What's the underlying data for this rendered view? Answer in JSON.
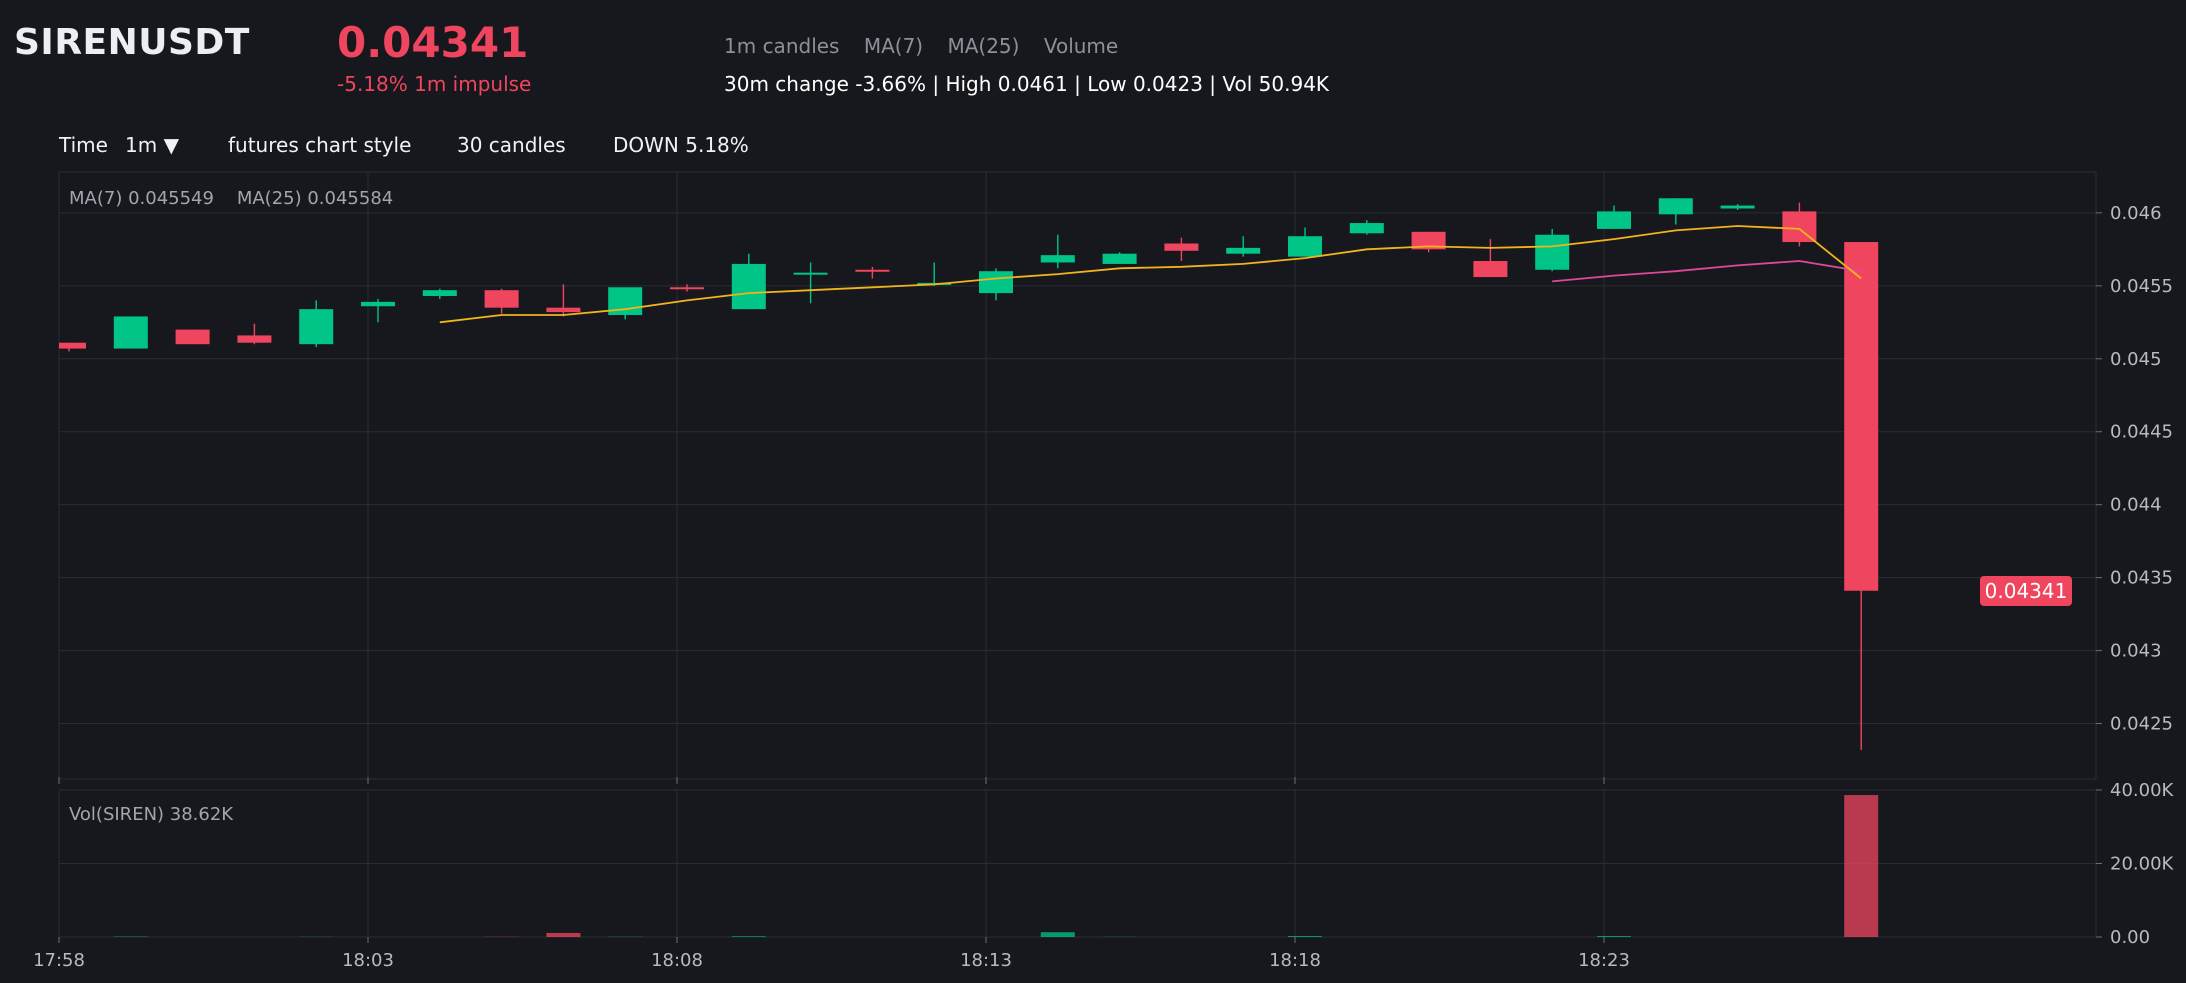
{
  "header": {
    "symbol": "SIRENUSDT",
    "price": "0.04341",
    "impulse": "-5.18% 1m impulse",
    "legend": {
      "candles": "1m candles",
      "ma7": "MA(7)",
      "ma25": "MA(25)",
      "volume": "Volume"
    },
    "stats": "30m change -3.66% | High 0.0461 | Low 0.0423 | Vol 50.94K"
  },
  "toolbar": {
    "time_label": "Time",
    "interval": "1m",
    "interval_arrow": "▼",
    "style_label": "futures chart style",
    "candles_label": "30 candles",
    "direction_label": "DOWN 5.18%"
  },
  "price_pane": {
    "ma_readout": "MA(7) 0.045549    MA(25) 0.045584"
  },
  "volume_pane": {
    "label": "Vol(SIREN) 38.62K"
  },
  "last_price_tag": "0.04341",
  "colors": {
    "background": "#17181d",
    "up": "#00c587",
    "down": "#f0455f",
    "ma7": "#f2b41c",
    "ma25": "#e0479b",
    "grid": "#2a2c33"
  },
  "chart_data": [
    {
      "type": "candlestick",
      "title": "SIRENUSDT",
      "interval": "1m",
      "x": [
        "17:58",
        "17:59",
        "18:00",
        "18:01",
        "18:02",
        "18:03",
        "18:04",
        "18:05",
        "18:06",
        "18:07",
        "18:08",
        "18:09",
        "18:10",
        "18:11",
        "18:12",
        "18:13",
        "18:14",
        "18:15",
        "18:16",
        "18:17",
        "18:18",
        "18:19",
        "18:20",
        "18:21",
        "18:22",
        "18:23",
        "18:24",
        "18:25",
        "18:26",
        "18:27"
      ],
      "x_ticks": [
        "17:58",
        "18:03",
        "18:08",
        "18:13",
        "18:18",
        "18:23"
      ],
      "open": [
        0.04511,
        0.04507,
        0.0452,
        0.04516,
        0.0451,
        0.04536,
        0.04543,
        0.04547,
        0.04535,
        0.0453,
        0.04549,
        0.04534,
        0.04558,
        0.04561,
        0.04551,
        0.04545,
        0.04566,
        0.04565,
        0.04579,
        0.04572,
        0.0457,
        0.04586,
        0.04587,
        0.04567,
        0.04561,
        0.04589,
        0.04599,
        0.04603,
        0.04601,
        0.0458
      ],
      "high": [
        0.04511,
        0.04529,
        0.0452,
        0.04524,
        0.0454,
        0.04541,
        0.04548,
        0.04548,
        0.04551,
        0.04548,
        0.04551,
        0.04572,
        0.04566,
        0.04563,
        0.04566,
        0.04562,
        0.04585,
        0.04573,
        0.04583,
        0.04584,
        0.0459,
        0.04595,
        0.04587,
        0.04582,
        0.04589,
        0.04605,
        0.0461,
        0.04606,
        0.04607,
        0.0458
      ],
      "low": [
        0.04505,
        0.04507,
        0.0451,
        0.0451,
        0.04508,
        0.04525,
        0.04541,
        0.04531,
        0.04529,
        0.04527,
        0.04546,
        0.04534,
        0.04538,
        0.04555,
        0.0455,
        0.0454,
        0.04562,
        0.04565,
        0.04567,
        0.0457,
        0.0457,
        0.04585,
        0.04573,
        0.04558,
        0.0456,
        0.04589,
        0.04592,
        0.04602,
        0.04577,
        0.04232
      ],
      "close": [
        0.04507,
        0.04529,
        0.0451,
        0.04511,
        0.04534,
        0.04539,
        0.04547,
        0.04535,
        0.04532,
        0.04549,
        0.04548,
        0.04565,
        0.04559,
        0.0456,
        0.04552,
        0.0456,
        0.04571,
        0.04572,
        0.04574,
        0.04576,
        0.04584,
        0.04593,
        0.04575,
        0.04556,
        0.04585,
        0.04601,
        0.0461,
        0.04605,
        0.0458,
        0.04341
      ],
      "ma7": [
        null,
        null,
        null,
        null,
        null,
        null,
        0.04525,
        0.0453,
        0.0453,
        0.04534,
        0.0454,
        0.04545,
        0.04547,
        0.04549,
        0.04551,
        0.04555,
        0.04558,
        0.04562,
        0.04563,
        0.04565,
        0.04569,
        0.04575,
        0.04577,
        0.04576,
        0.04577,
        0.04582,
        0.04588,
        0.04591,
        0.04589,
        0.04555
      ],
      "ma25": [
        null,
        null,
        null,
        null,
        null,
        null,
        null,
        null,
        null,
        null,
        null,
        null,
        null,
        null,
        null,
        null,
        null,
        null,
        null,
        null,
        null,
        null,
        null,
        null,
        0.04553,
        0.04557,
        0.0456,
        0.04564,
        0.04567,
        0.0456
      ],
      "volume": [
        0,
        120,
        0,
        0,
        50,
        0,
        0,
        60,
        1100,
        60,
        0,
        200,
        0,
        0,
        0,
        0,
        1300,
        50,
        0,
        0,
        250,
        0,
        0,
        0,
        0,
        250,
        0,
        0,
        0,
        38620
      ],
      "y_ticks": [
        "0.046",
        "0.0455",
        "0.045",
        "0.0445",
        "0.044",
        "0.0435",
        "0.043",
        "0.0425"
      ],
      "ylim": [
        0.04212,
        0.04628
      ],
      "volume_ticks": [
        "40.00K",
        "20.00K",
        "0.00"
      ],
      "volume_ylim": [
        0,
        40000
      ]
    }
  ]
}
